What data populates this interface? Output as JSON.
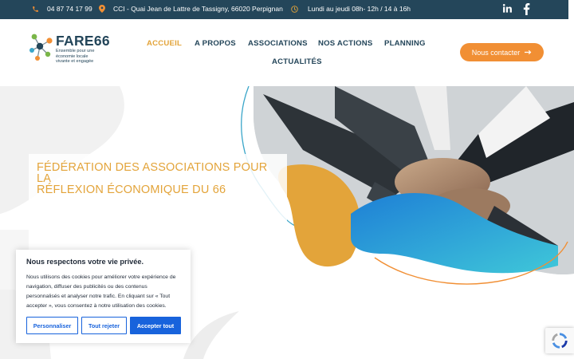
{
  "topbar": {
    "phone": "04 87 74 17 99",
    "address": "CCI - Quai Jean de Lattre de Tassigny, 66020 Perpignan",
    "hours": "Lundi au jeudi 08h- 12h / 14 à 16h",
    "social_icons": [
      "linkedin-icon",
      "facebook-icon"
    ]
  },
  "logo": {
    "title": "FARE66",
    "tagline": [
      "Ensemble pour une",
      "économie locale",
      "vivante et engagée"
    ]
  },
  "nav": {
    "items": [
      "ACCUEIL",
      "A PROPOS",
      "ASSOCIATIONS",
      "NOS ACTIONS",
      "PLANNING",
      "ACTUALITÉS"
    ],
    "active": "ACCUEIL"
  },
  "contact_button": {
    "label": "Nous contacter"
  },
  "hero": {
    "title_line1": "FÉDÉRATION DES ASSOCIATIONS POUR LA",
    "title_line2": "RÉFLEXION ÉCONOMIQUE DU 66"
  },
  "cookie": {
    "title": "Nous respectons votre vie privée.",
    "text_lines": [
      "Nous utilisons des cookies pour améliorer votre expérience de",
      "navigation, diffuser des publicités ou des contenus",
      "personnalisés et analyser notre trafic. En cliquant sur « Tout",
      "accepter », vous consentez à notre utilisation des cookies."
    ],
    "btn_customize": "Personnaliser",
    "btn_reject": "Tout rejeter",
    "btn_accept": "Accepter tout"
  },
  "colors": {
    "brand_dark": "#24465a",
    "accent_orange": "#f18f34",
    "accent_gold": "#e3a43a",
    "cookie_blue": "#1863dc"
  }
}
